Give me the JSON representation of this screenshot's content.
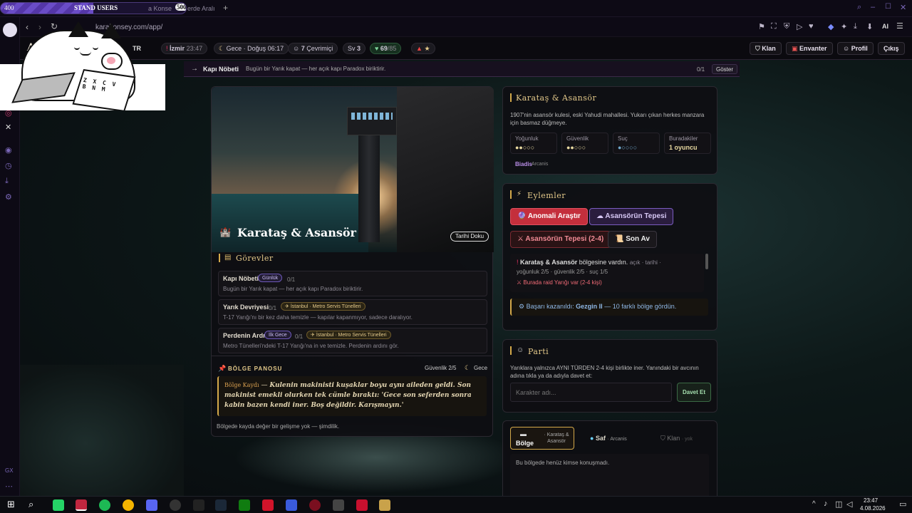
{
  "browser": {
    "stand_left": "400",
    "stand_title": "STAND USERS",
    "stand_right": "500",
    "stand_progress": 0.5,
    "tab_fragment_1": "a Konse",
    "tab_fragment_2": "erde Aralı",
    "url": "karakonsey.com/app/",
    "ai_label": "AI"
  },
  "topbar": {
    "brand": "AF",
    "lang": "TR",
    "city": "İzmir",
    "city_time": "23:47",
    "time_phase": "Gece · Doğuş 06:17",
    "online_count": "7",
    "online_label": "Çevrimiçi",
    "level_label": "Sv",
    "level": "3",
    "hp": "69",
    "hp_max": "/85",
    "klan": "Klan",
    "envanter": "Envanter",
    "profil": "Profil",
    "cikis": "Çıkış"
  },
  "quest_strip": {
    "title": "Kapı Nöbeti",
    "desc": "Bugün bir Yarık kapat — her açık kapı Paradox biriktirir.",
    "progress": "0/1",
    "show": "Göster"
  },
  "hero": {
    "title": "Karataş & Asansör",
    "badge": "Tarihi Doku"
  },
  "tasks": {
    "title": "Görevler",
    "items": [
      {
        "name": "Kapı Nöbeti",
        "tag": "Günlük",
        "progress": "0/1",
        "desc": "Bugün bir Yarık kapat — her açık kapı Paradox biriktirir."
      },
      {
        "name": "Yarık Devriyesi",
        "progress": "0/1",
        "tag": "İstanbul · Metro Servis Tünelleri",
        "desc": "T-17 Yarığı'nı bir kez daha temizle — kapılar kapanmıyor, sadece daralıyor."
      },
      {
        "name": "Perdenin Ardı",
        "tag": "İlk Gece",
        "progress": "0/1",
        "tag2": "İstanbul · Metro Servis Tünelleri",
        "desc": "Metro Tünelleri'ndeki T-17 Yarığı'na in ve temizle. Perdenin ardını gör."
      }
    ]
  },
  "board": {
    "title": "BÖLGE PANOSU",
    "safety": "Güvenlik 2/5",
    "phase": "Gece",
    "record_label": "Bölge Kaydı",
    "record_text": "Kulenin makinisti kuşaklar boyu aynı aileden geldi. Son makinist emekli olurken tek cümle bıraktı: 'Gece son seferden sonra kabin bazen kendi iner. Boş değildir. Karışmayın.'",
    "footer": "Bölgede kayda değer bir gelişme yok — şimdilik."
  },
  "location": {
    "title": "Karataş & Asansör",
    "desc": "1907'nin asansör kulesi, eski Yahudi mahallesi. Yukarı çıkan herkes manzara için basmaz düğmeye.",
    "stats": [
      {
        "k": "Yoğunluk",
        "v": "●●○○○"
      },
      {
        "k": "Güvenlik",
        "v": "●●○○○"
      },
      {
        "k": "Suç",
        "v": "●○○○○"
      },
      {
        "k": "Buradakiler",
        "v": "1 oyuncu"
      }
    ],
    "npc": "Biadis",
    "npc_faction": "Arcanis"
  },
  "actions": {
    "title": "Eylemler",
    "b1": "Anomali Araştır",
    "b2": "Asansörün Tepesi",
    "b3": "Asansörün Tepesi (2-4)",
    "b4": "Son Av",
    "log_region": "Karataş & Asansör",
    "log_arrived": "bölgesine vardın.",
    "log_meta1": "açık · tarihi ·",
    "log_meta2": "yoğunluk 2/5 · güvenlik 2/5 · suç 1/5",
    "log_raid": "Burada raid Yarığı var (2-4 kişi)",
    "achv_prefix": "Başarı kazanıldı:",
    "achv_name": "Gezgin II",
    "achv_suffix": "— 10 farklı bölge gördün."
  },
  "party": {
    "title": "Parti",
    "desc": "Yarıklara yalnızca AYNI TÜRDEN 2-4 kişi birlikte iner. Yanındaki bir avcının adına tıkla ya da adıyla davet et:",
    "placeholder": "Karakter adı...",
    "invite": "Davet Et"
  },
  "chat": {
    "tab1": "Bölge",
    "tab1_sub": "· Karataş & Asansör",
    "tab2": "Saf",
    "tab2_sub": "· Arcanis",
    "tab3": "Klan",
    "tab3_sub": "· yok",
    "empty": "Bu bölgede henüz kimse konuşmadı."
  },
  "sticker": {
    "keys": "Z X C V B N M"
  },
  "taskbar": {
    "time": "23:47",
    "date": "4.08.2026"
  }
}
